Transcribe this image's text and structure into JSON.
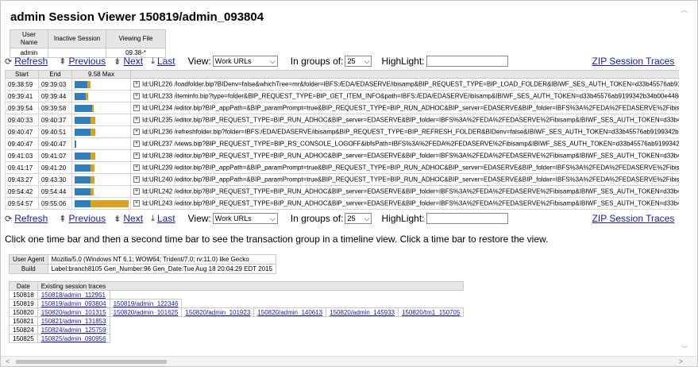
{
  "title": "admin Session Viewer 150819/admin_093804",
  "userinfo": {
    "headers": [
      "User Name",
      "Inactive Session",
      "Viewing File"
    ],
    "values": [
      "admin",
      "",
      "09.38-*"
    ]
  },
  "nav": {
    "refresh": "Refresh",
    "previous": "Previous",
    "next": "Next",
    "last": "Last",
    "view_label": "View:",
    "view_value": "Work URLs",
    "groups_label": "In groups of:",
    "groups_value": "25",
    "highlight_label": "HighLight:",
    "highlight_value": "",
    "zip": "ZIP Session Traces"
  },
  "traces": {
    "headers": [
      "Start",
      "End",
      "9.58 Max",
      ""
    ],
    "rows": [
      {
        "start": "09:38:59",
        "end": "09:39:03",
        "blue": 0.24,
        "orange": 0.06,
        "url": "Id:URL226 /loadfolder.bip?BIDenv=false&whichTree=mr&folder=IBFS:/EDA/EDASERVE/ibisamp&BIP_REQUEST_TYPE=BIP_LOAD_FOLDER&IBIWF_SES_AUTH_TOKEN=d33b45576ab9199342b34b00e4"
      },
      {
        "start": "09:39:41",
        "end": "09:39:44",
        "blue": 0.2,
        "orange": 0.05,
        "url": "Id:URL233 /iteminfo.bip?type=folder&BIP_REQUEST_TYPE=BIP_GET_ITEM_INFO&path=IBFS:/EDA/EDASERVE/ibisamp&IBIWF_SES_AUTH_TOKEN=d33b45576ab9199342b34b00e448d2b3&IBI_rando"
      },
      {
        "start": "09:39:54",
        "end": "09:39:58",
        "blue": 0.33,
        "orange": 0.03,
        "url": "Id:URL234 /editor.bip?BIP_appPath=&BIP_paramPrompt=true&BIP_REQUEST_TYPE=BIP_RUN_ADHOC&BIP_server=EDASERVE&BIP_folder=IBFS%3A%2FEDA%2FEDASERVE%2Fibisamp&IBIWF_SES"
      },
      {
        "start": "09:40:33",
        "end": "09:40:37",
        "blue": 0.3,
        "orange": 0.09,
        "url": "Id:URL235 /editor.bip?BIP_REQUEST_TYPE=BIP_RUN_ADHOC&BIP_server=EDASERVE&BIP_folder=IBFS%3A%2FEDA%2FEDASERVE%2Fibisamp&IBIWF_SES_AUTH_TOKEN=d33b45576ab9199342b3"
      },
      {
        "start": "09:40:47",
        "end": "09:40:51",
        "blue": 0.3,
        "orange": 0.09,
        "url": "Id:URL236 /refreshfolder.bip?folder=IBFS:/EDA/EDASERVE/ibisamp&BIP_REQUEST_TYPE=BIP_REFRESH_FOLDER&BIDenv=false&IBIWF_SES_AUTH_TOKEN=d33b45576ab9199342b34b00e448d2b3&"
      },
      {
        "start": "09:40:47",
        "end": "09:40:47",
        "blue": 0.03,
        "orange": 0.0,
        "url": "Id:URL237 /views.bip?BIP_REQUEST_TYPE=BIP_RS_CONSOLE_LOGOFF&ibfsPath=IBFS%3A%2FEDA%2FEDASERVE%2Fibisamp&IBIWF_SES_AUTH_TOKEN=d33b45576ab9199342b34b00e448d2b3&IBI_random="
      },
      {
        "start": "09:41:03",
        "end": "09:41:07",
        "blue": 0.3,
        "orange": 0.09,
        "url": "Id:URL238 /editor.bip?BIP_REQUEST_TYPE=BIP_RUN_ADHOC&BIP_server=EDASERVE&BIP_folder=IBFS%3A%2FEDA%2FEDASERVE%2Fibisamp&IBIWF_SES_AUTH_TOKEN=d33b45576ab9199342b3"
      },
      {
        "start": "09:41:17",
        "end": "09:41:20",
        "blue": 0.3,
        "orange": 0.08,
        "url": "Id:URL239 /editor.bip?BIP_appPath=&BIP_paramPrompt=true&BIP_REQUEST_TYPE=BIP_RUN_ADHOC&BIP_server=EDASERVE&BIP_folder=IBFS%3A%2FEDA%2FEDASERVE%2Fibisamp&IBIWF_SES"
      },
      {
        "start": "09:43:27",
        "end": "09:43:30",
        "blue": 0.3,
        "orange": 0.08,
        "url": "Id:URL240 /editor.bip?BIP_appPath=&BIP_paramPrompt=true&BIP_REQUEST_TYPE=BIP_RUN_ADHOC&BIP_server=EDASERVE&BIP_folder=IBFS%3A%2FEDA%2FEDASERVE%2Fibisamp&IBIWF_SES"
      },
      {
        "start": "09:54:42",
        "end": "09:54:44",
        "blue": 0.3,
        "orange": 0.06,
        "url": "Id:URL242 /editor.bip?BIP_REQUEST_TYPE=BIP_RUN_ADHOC&BIP_server=EDASERVE&BIP_folder=IBFS%3A%2FEDA%2FEDASERVE%2Fibisamp&IBIWF_SES_AUTH_TOKEN=d33b45576ab9199342b3"
      },
      {
        "start": "09:54:57",
        "end": "09:55:06",
        "blue": 0.3,
        "orange": 0.7,
        "url": "Id:URL243 /editor.bip?BIP_REQUEST_TYPE=BIP_RUN_ADHOC&BIP_server=EDASERVE&BIP_folder=IBFS%3A%2FEDA%2FEDASERVE%2Fibisamp&IBIWF_SES_AUTH_TOKEN=d33b45576ab9199342b3"
      }
    ]
  },
  "instructions": "Click one time bar and then a second time bar to see the transaction group in a timeline view. Click a time bar to restore the view.",
  "agent": {
    "user_agent_label": "User Agent",
    "user_agent_value": "Mozilla/5.0 (Windows NT 6.1; WOW64; Trident/7.0; rv:11.0) like Gecko",
    "build_label": "Build",
    "build_value": "Label:branch8105 Gen_Number:96 Gen_Date:Tue Aug 18 20:04:29 EDT 2015"
  },
  "sessions": {
    "headers": [
      "Date",
      "Existing session traces"
    ],
    "rows": [
      {
        "date": "150818",
        "traces": [
          "150818/admin_112951"
        ]
      },
      {
        "date": "150819",
        "traces": [
          "150819/admin_093804",
          "150819/admin_122346"
        ]
      },
      {
        "date": "150820",
        "traces": [
          "150820/admin_101315",
          "150820/admin_101625",
          "150820/admin_101923",
          "150820/admin_140613",
          "150820/admin_145933",
          "150820/tm1_150705"
        ]
      },
      {
        "date": "150821",
        "traces": [
          "150821/admin_131853"
        ]
      },
      {
        "date": "150824",
        "traces": [
          "150824/admin_125759"
        ]
      },
      {
        "date": "150825",
        "traces": [
          "150825/admin_090956"
        ]
      }
    ]
  },
  "colors": {
    "bar_blue": "#2f7fc0",
    "bar_orange": "#d9a21b",
    "link": "#1a1ab8",
    "header_bg": "#e6e6e6"
  },
  "icons": {
    "refresh": "refresh-icon",
    "previous": "page-up-icon",
    "next": "page-down-icon",
    "last": "last-page-icon"
  }
}
